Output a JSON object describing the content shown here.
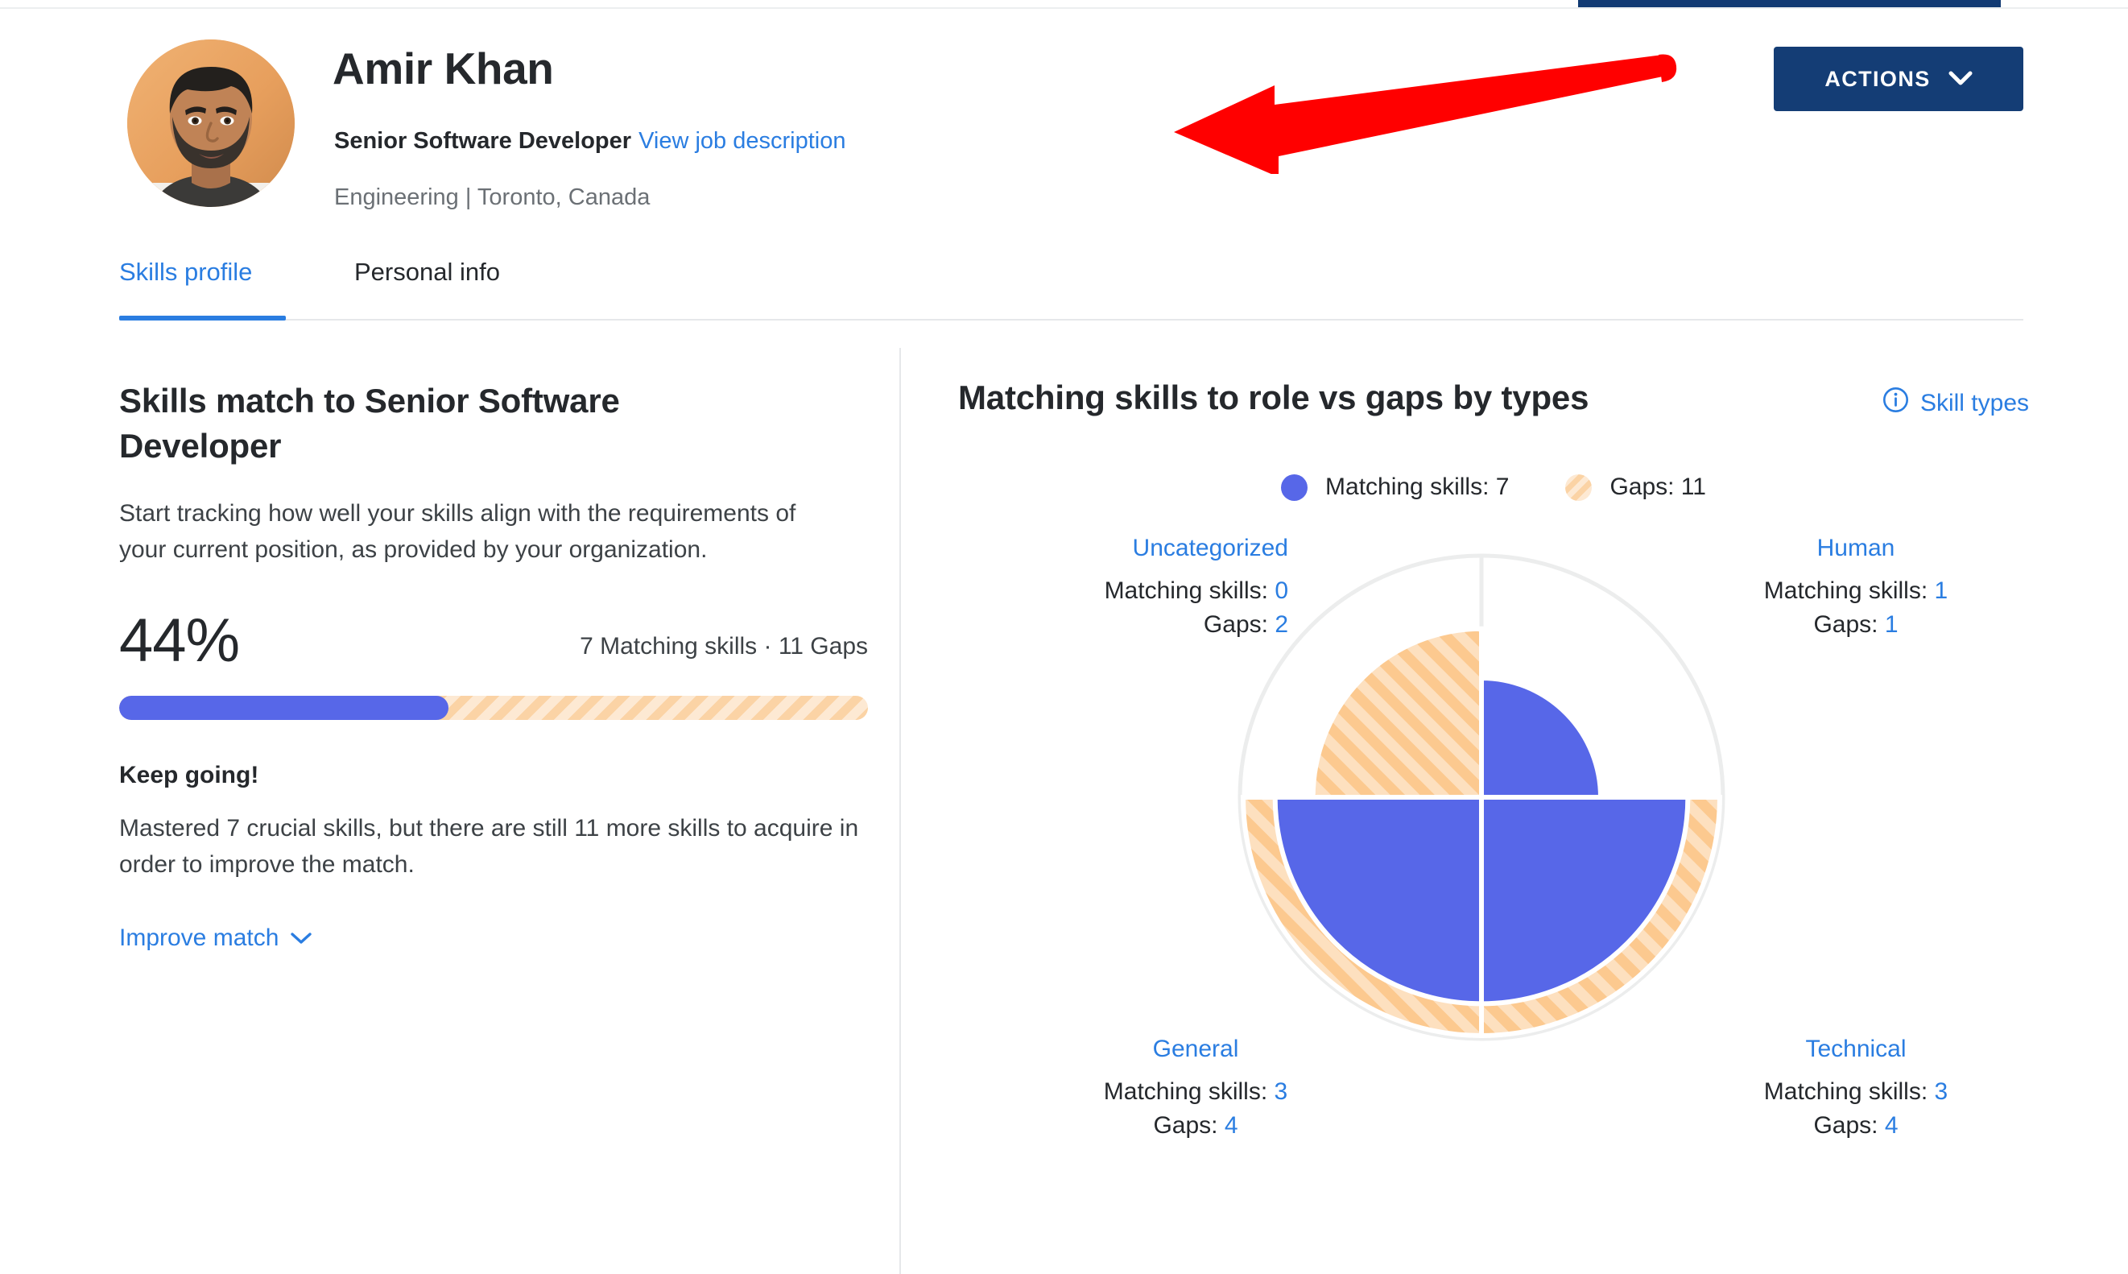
{
  "colors": {
    "brand_navy": "#143d75",
    "link_blue": "#2a7de1",
    "matching_blue": "#5767e8",
    "gap_orange": "#fbd3a5",
    "annotation_red": "#ff0000"
  },
  "header": {
    "name": "Amir Khan",
    "role_title": "Senior Software Developer",
    "job_description_link": "View job description",
    "department_location": "Engineering | Toronto, Canada",
    "actions_button": "ACTIONS"
  },
  "tabs": [
    {
      "label": "Skills profile",
      "active": true
    },
    {
      "label": "Personal info",
      "active": false
    }
  ],
  "left_panel": {
    "title": "Skills match to Senior Software Developer",
    "description": "Start tracking how well your skills align with the requirements of your current position, as provided by your organization.",
    "percent": "44%",
    "percent_value": 44,
    "summary": "7 Matching skills · 11 Gaps",
    "encouragement_title": "Keep going!",
    "encouragement_body": "Mastered 7 crucial skills, but there are still 11 more skills to acquire in order to improve the match.",
    "improve_link": "Improve match"
  },
  "right_panel": {
    "title": "Matching skills to role vs gaps by types",
    "skill_types_link": "Skill types",
    "legend": [
      {
        "label": "Matching skills: 7",
        "swatch": "blue"
      },
      {
        "label": "Gaps: 11",
        "swatch": "striped"
      }
    ],
    "quadrants": {
      "uncategorized": {
        "name": "Uncategorized",
        "matching_label": "Matching skills:",
        "matching": "0",
        "gaps_label": "Gaps:",
        "gaps": "2"
      },
      "human": {
        "name": "Human",
        "matching_label": "Matching skills:",
        "matching": "1",
        "gaps_label": "Gaps:",
        "gaps": "1"
      },
      "general": {
        "name": "General",
        "matching_label": "Matching skills:",
        "matching": "3",
        "gaps_label": "Gaps:",
        "gaps": "4"
      },
      "technical": {
        "name": "Technical",
        "matching_label": "Matching skills:",
        "matching": "3",
        "gaps_label": "Gaps:",
        "gaps": "4"
      }
    }
  },
  "chart_data": {
    "type": "pie",
    "title": "Matching skills to role vs gaps by types",
    "subtype": "polar-area-quadrants",
    "categories": [
      "Uncategorized",
      "Human",
      "General",
      "Technical"
    ],
    "series": [
      {
        "name": "Matching skills",
        "values": [
          0,
          1,
          3,
          3
        ],
        "color": "#5767e8"
      },
      {
        "name": "Gaps",
        "values": [
          2,
          1,
          4,
          4
        ],
        "color": "#fbd3a5"
      }
    ],
    "totals": {
      "matching_skills": 7,
      "gaps": 11,
      "match_percent": 44
    },
    "quadrant_positions": {
      "Uncategorized": "top-left",
      "Human": "top-right",
      "General": "bottom-left",
      "Technical": "bottom-right"
    },
    "legend": [
      "Matching skills: 7",
      "Gaps: 11"
    ],
    "grid": true,
    "legend_position": "top"
  },
  "annotation": {
    "type": "arrow",
    "points_to": "View job description",
    "color": "#ff0000"
  },
  "icons": {
    "chevron_down": "chevron-down-icon",
    "info": "info-circle-icon"
  }
}
